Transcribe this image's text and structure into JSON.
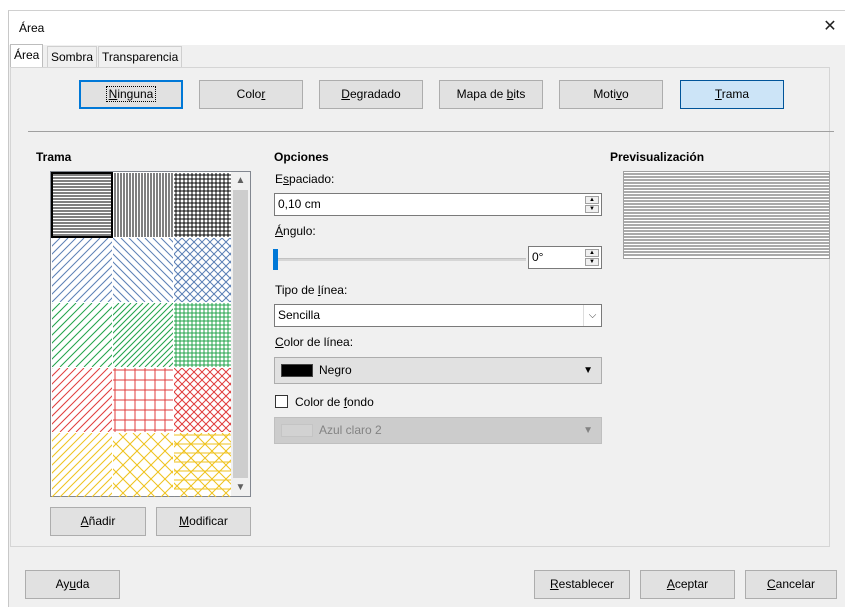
{
  "window": {
    "title": "Área",
    "close_glyph": "✕"
  },
  "tabs": [
    {
      "label": "Área",
      "active": true
    },
    {
      "label": "Sombra",
      "active": false
    },
    {
      "label": "Transparencia",
      "active": false
    }
  ],
  "fill_types": [
    {
      "pre": "",
      "u": "N",
      "post": "inguna",
      "state": "focused"
    },
    {
      "pre": "Colo",
      "u": "r",
      "post": "",
      "state": "normal"
    },
    {
      "pre": "",
      "u": "D",
      "post": "egradado",
      "state": "normal"
    },
    {
      "pre": "Mapa de ",
      "u": "b",
      "post": "its",
      "state": "normal"
    },
    {
      "pre": "Moti",
      "u": "v",
      "post": "o",
      "state": "normal"
    },
    {
      "pre": "",
      "u": "T",
      "post": "rama",
      "state": "pressed"
    }
  ],
  "hatch": {
    "heading": "Trama",
    "patterns": [
      {
        "color": "#000000",
        "style": "horizontal",
        "selected": true
      },
      {
        "color": "#000000",
        "style": "vertical"
      },
      {
        "color": "#000000",
        "style": "grid"
      },
      {
        "color": "#5b7fb5",
        "style": "diag-right"
      },
      {
        "color": "#5b7fb5",
        "style": "diag-left"
      },
      {
        "color": "#5b7fb5",
        "style": "cross-diag"
      },
      {
        "color": "#21a34a",
        "style": "diag-right"
      },
      {
        "color": "#21a34a",
        "style": "diag-right-dense"
      },
      {
        "color": "#21a34a",
        "style": "grid"
      },
      {
        "color": "#e03c3c",
        "style": "diag-right"
      },
      {
        "color": "#e03c3c",
        "style": "grid-wide"
      },
      {
        "color": "#e03c3c",
        "style": "cross-diag"
      },
      {
        "color": "#efc21e",
        "style": "diag-right"
      },
      {
        "color": "#efc21e",
        "style": "cross-diag-wide"
      },
      {
        "color": "#efc21e",
        "style": "triple"
      }
    ],
    "add": {
      "pre": "",
      "u": "A",
      "post": "ñadir"
    },
    "modify": {
      "pre": "",
      "u": "M",
      "post": "odificar"
    }
  },
  "options": {
    "heading": "Opciones",
    "spacing": {
      "pre": "E",
      "u": "s",
      "post": "paciado:",
      "value": "0,10 cm"
    },
    "angle": {
      "pre": "",
      "u": "Á",
      "post": "ngulo:",
      "value": "0°",
      "slider_fraction": 0
    },
    "line_type": {
      "pre": "Tipo de ",
      "u": "l",
      "post": "ínea:",
      "value": "Sencilla"
    },
    "line_color": {
      "pre": "",
      "u": "C",
      "post": "olor de línea:",
      "value": "Negro",
      "swatch": "#000000"
    },
    "bg_color": {
      "pre": "Color de ",
      "u": "f",
      "post": "ondo",
      "checked": false,
      "value": "Azul claro 2"
    }
  },
  "preview": {
    "heading": "Previsualización"
  },
  "footer": {
    "help": {
      "pre": "Ay",
      "u": "u",
      "post": "da"
    },
    "reset": {
      "pre": "",
      "u": "R",
      "post": "establecer"
    },
    "ok": {
      "pre": "",
      "u": "A",
      "post": "ceptar"
    },
    "cancel": {
      "pre": "",
      "u": "C",
      "post": "ancelar"
    }
  }
}
